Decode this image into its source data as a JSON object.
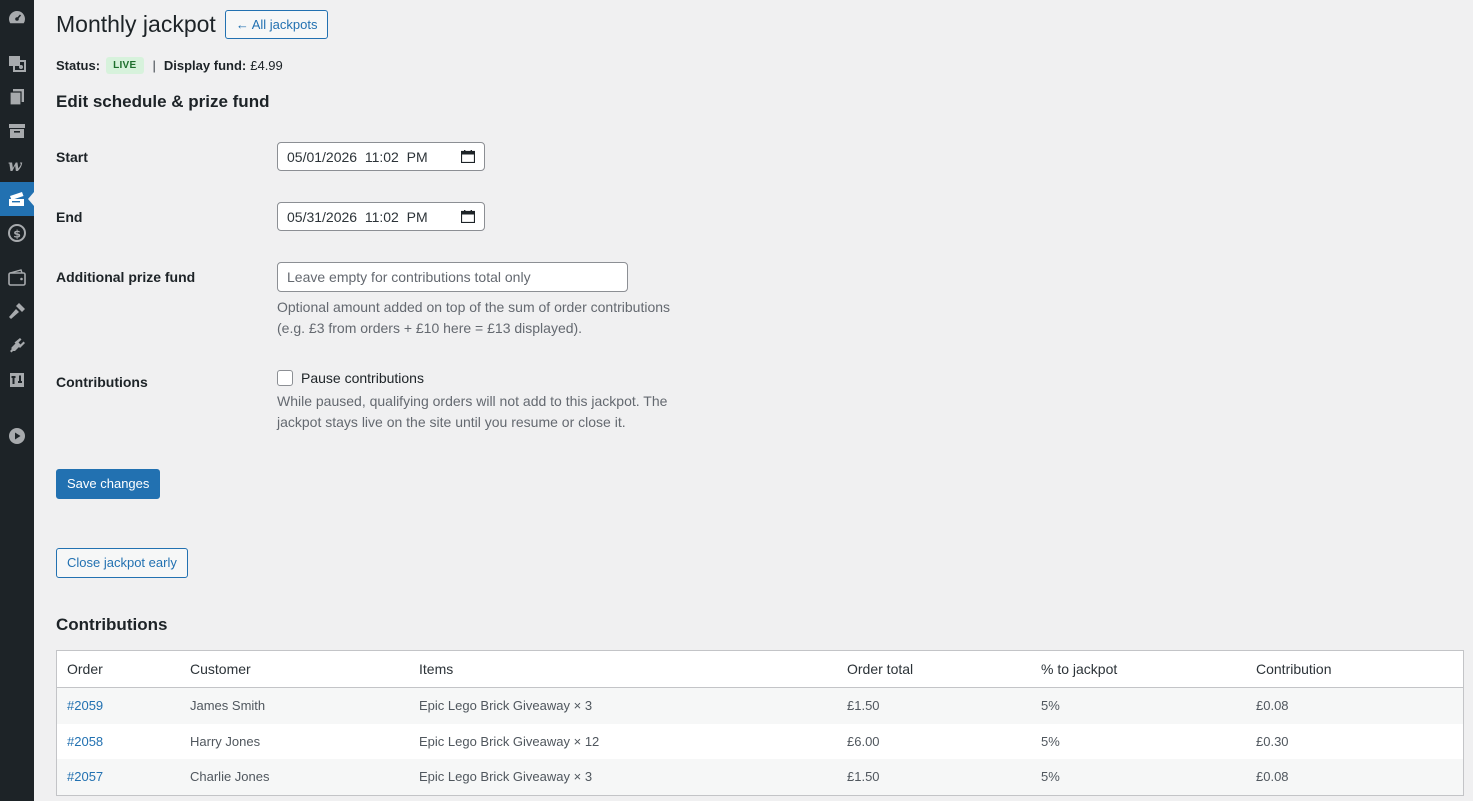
{
  "sidebar": {
    "icons": [
      "dashboard-icon",
      "media-icon",
      "pages-icon",
      "archive-icon",
      "woo-icon",
      "tickets-icon",
      "dollar-icon",
      "wallet-icon",
      "tools-icon",
      "plugins-icon",
      "settings-icon",
      "play-icon"
    ],
    "active": "tickets-icon"
  },
  "header": {
    "title": "Monthly jackpot",
    "back_button": "← All jackpots"
  },
  "status": {
    "label": "Status:",
    "badge": "LIVE",
    "separator": "|",
    "fund_label": "Display fund:",
    "fund_value": "£4.99"
  },
  "schedule": {
    "heading": "Edit schedule & prize fund",
    "start_label": "Start",
    "start_value": "05/01/2026  11:02  PM",
    "end_label": "End",
    "end_value": "05/31/2026  11:02  PM",
    "prize_label": "Additional prize fund",
    "prize_placeholder": "Leave empty for contributions total only",
    "prize_desc_1": "Optional amount added on top of the sum of order contributions",
    "prize_desc_2": "(e.g. £3 from orders + £10 here = £13 displayed).",
    "contrib_label": "Contributions",
    "pause_label": "Pause contributions",
    "pause_desc_1": "While paused, qualifying orders will not add to this jackpot. The",
    "pause_desc_2": "jackpot stays live on the site until you resume or close it.",
    "save_button": "Save changes"
  },
  "close_button": "Close jackpot early",
  "contributions": {
    "heading": "Contributions",
    "columns": [
      "Order",
      "Customer",
      "Items",
      "Order total",
      "% to jackpot",
      "Contribution"
    ],
    "rows": [
      {
        "order": "#2059",
        "customer": "James Smith",
        "items": "Epic Lego Brick Giveaway × 3",
        "total": "£1.50",
        "pct": "5%",
        "contribution": "£0.08"
      },
      {
        "order": "#2058",
        "customer": "Harry Jones",
        "items": "Epic Lego Brick Giveaway × 12",
        "total": "£6.00",
        "pct": "5%",
        "contribution": "£0.30"
      },
      {
        "order": "#2057",
        "customer": "Charlie Jones",
        "items": "Epic Lego Brick Giveaway × 3",
        "total": "£1.50",
        "pct": "5%",
        "contribution": "£0.08"
      }
    ]
  },
  "colors": {
    "sidebar": "#1d2327",
    "accent": "#2271b1",
    "background": "#f0f0f1",
    "live_badge_bg": "#d7f2dc",
    "live_badge_text": "#1e6f2d"
  }
}
